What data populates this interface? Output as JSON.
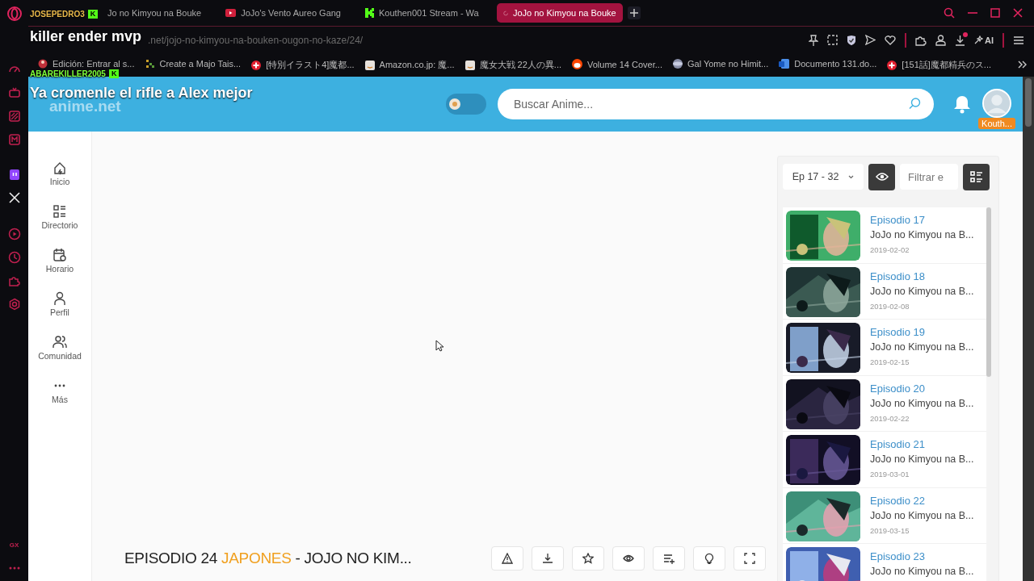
{
  "browser": {
    "tabs": [
      {
        "title": "Jo no Kimyou na Bouke",
        "selected": false
      },
      {
        "title": "JoJo's Vento Aureo Gang",
        "kind": "video",
        "selected": false
      },
      {
        "title": "Kouthen001 Stream - Wa",
        "kind": "k",
        "selected": false
      },
      {
        "title": "JoJo no Kimyou na Bouke",
        "kind": "loading",
        "selected": true
      }
    ],
    "url": ".net/jojo-no-kimyou-na-bouken-ougon-no-kaze/24/",
    "ai_label": "AI",
    "download_notification": true,
    "bookmarks": [
      {
        "label": "Edición: Entrar al s...",
        "kind": "figure"
      },
      {
        "label": "Create a Majo Tais...",
        "kind": "grid"
      },
      {
        "label": "[特別イラスト4]魔都...",
        "kind": "cross"
      },
      {
        "label": "Amazon.co.jp: 魔...",
        "kind": "square"
      },
      {
        "label": "魔女大戦 22人の異...",
        "kind": "square"
      },
      {
        "label": "Volume 14 Cover...",
        "kind": "face"
      },
      {
        "label": "Gal Yome no Himit...",
        "kind": "globe"
      },
      {
        "label": "Documento 131.do...",
        "kind": "doc"
      },
      {
        "label": "[151話]魔都精兵のス...",
        "kind": "cross"
      }
    ],
    "sidebar_label": "GX"
  },
  "chat_overlay": [
    {
      "user": "JOSEPEDRO3",
      "color": "#e8b84a",
      "badge": "K",
      "message": "killer ender mvp"
    },
    {
      "user": "ABAREKILLER2005",
      "color": "#7dff3a",
      "badge": "K",
      "message": "Ya cromenle el rifle a Alex mejor"
    }
  ],
  "site": {
    "logo": "anime.net",
    "theme_toggle": {
      "on": false
    },
    "search": {
      "placeholder": "Buscar Anime..."
    },
    "user_badge": "Kouth...",
    "nav": [
      {
        "label": "Inicio",
        "kind": "home"
      },
      {
        "label": "Directorio",
        "kind": "directory"
      },
      {
        "label": "Horario",
        "kind": "schedule"
      },
      {
        "label": "Perfil",
        "kind": "profile"
      },
      {
        "label": "Comunidad",
        "kind": "community"
      },
      {
        "label": "Más",
        "kind": "more"
      }
    ]
  },
  "player": {
    "episode": "EPISODIO 24",
    "language": "JAPONES",
    "rest": "- JOJO NO KIM..."
  },
  "episodes": {
    "range": "Ep 17 - 32",
    "filter_placeholder": "Filtrar e",
    "items": [
      {
        "title": "Episodio 17",
        "series": "JoJo no Kimyou na B...",
        "date": "2019-02-02"
      },
      {
        "title": "Episodio 18",
        "series": "JoJo no Kimyou na B...",
        "date": "2019-02-08"
      },
      {
        "title": "Episodio 19",
        "series": "JoJo no Kimyou na B...",
        "date": "2019-02-15"
      },
      {
        "title": "Episodio 20",
        "series": "JoJo no Kimyou na B...",
        "date": "2019-02-22"
      },
      {
        "title": "Episodio 21",
        "series": "JoJo no Kimyou na B...",
        "date": "2019-03-01"
      },
      {
        "title": "Episodio 22",
        "series": "JoJo no Kimyou na B...",
        "date": "2019-03-15"
      },
      {
        "title": "Episodio 23",
        "series": "JoJo no Kimyou na B..."
      }
    ]
  }
}
